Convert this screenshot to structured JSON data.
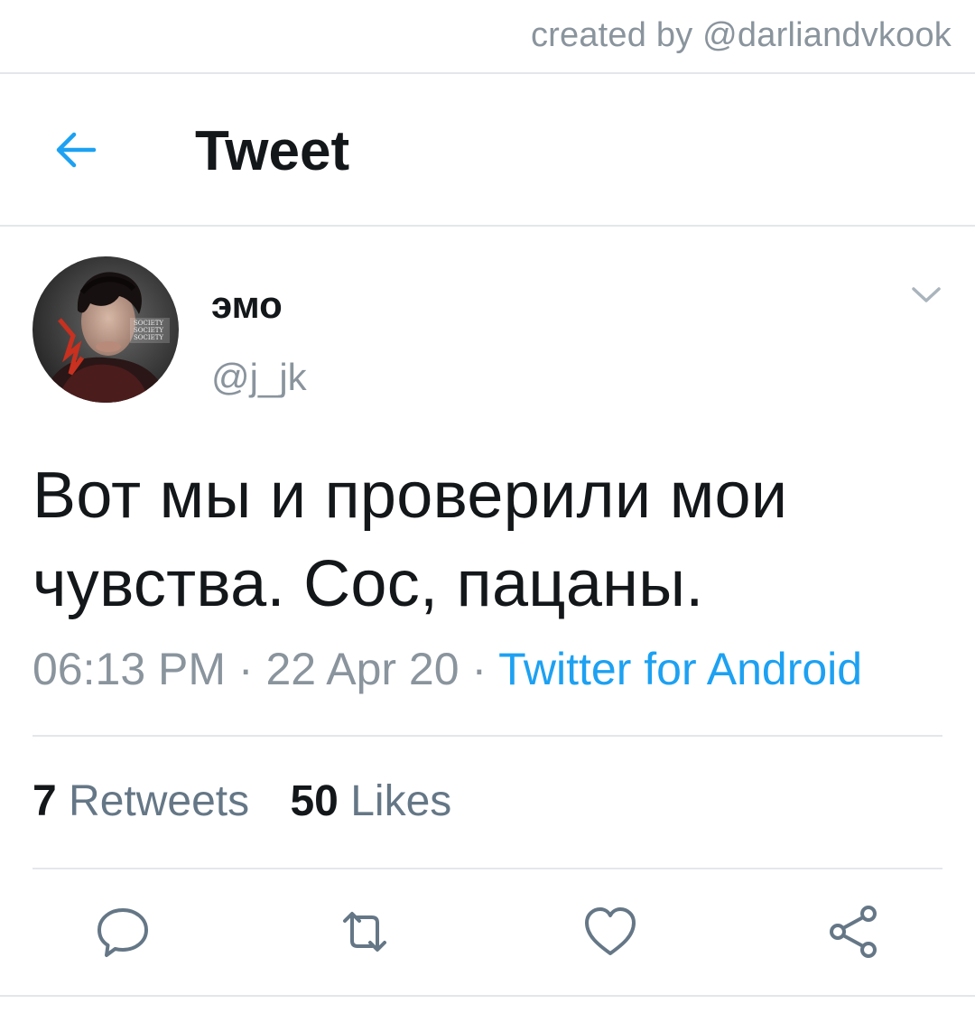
{
  "credit": "created by @darliandvkook",
  "header": {
    "title": "Tweet",
    "back_icon": "arrow-left-icon"
  },
  "tweet": {
    "author_name": "эмо",
    "author_handle": "@j_jk",
    "text_line1": "Вот мы и проверили мои",
    "text_line2": "чувства. Сос, пацаны.",
    "time": "06:13 PM",
    "separator": "·",
    "date": "22 Apr 20",
    "source": "Twitter for Android"
  },
  "stats": {
    "retweets_count": "7",
    "retweets_label": "Retweets",
    "likes_count": "50",
    "likes_label": "Likes"
  },
  "actions": {
    "reply_icon": "reply-icon",
    "retweet_icon": "retweet-icon",
    "like_icon": "heart-icon",
    "share_icon": "share-icon"
  },
  "colors": {
    "accent": "#1da1f2",
    "text_primary": "#14171a",
    "text_secondary": "#8a949d",
    "icon_gray": "#657786",
    "divider": "#e3e7ea"
  }
}
